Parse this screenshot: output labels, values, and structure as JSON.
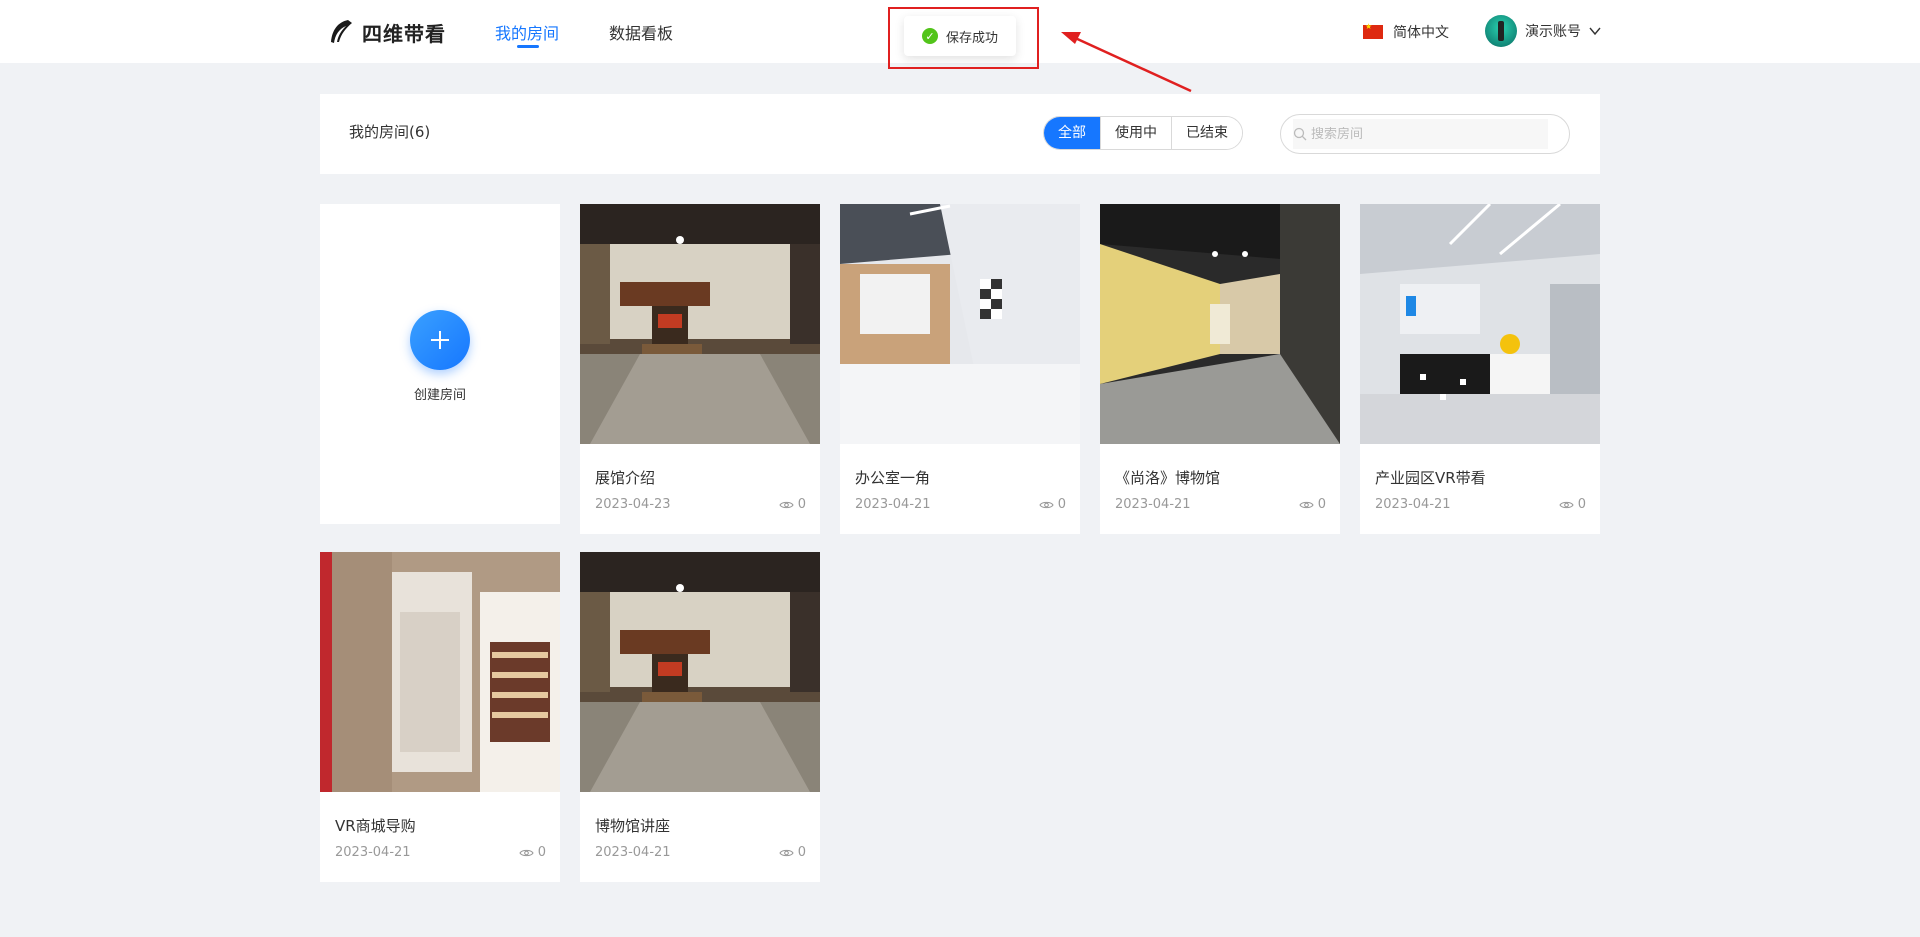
{
  "header": {
    "logo_text": "四维带看",
    "nav": [
      {
        "label": "我的房间",
        "active": true
      },
      {
        "label": "数据看板",
        "active": false
      }
    ],
    "language": "简体中文",
    "account": "演示账号"
  },
  "toast": {
    "message": "保存成功",
    "status_color": "#52c41a"
  },
  "toolbar": {
    "title": "我的房间(6)",
    "filters": [
      {
        "label": "全部",
        "active": true
      },
      {
        "label": "使用中",
        "active": false
      },
      {
        "label": "已结束",
        "active": false
      }
    ],
    "search_placeholder": "搜索房间"
  },
  "create": {
    "label": "创建房间"
  },
  "rooms": [
    {
      "name": "展馆介绍",
      "date": "2023-04-23",
      "views": "0",
      "scene": "hall"
    },
    {
      "name": "办公室一角",
      "date": "2023-04-21",
      "views": "0",
      "scene": "office"
    },
    {
      "name": "《尚洛》博物馆",
      "date": "2023-04-21",
      "views": "0",
      "scene": "museum"
    },
    {
      "name": "产业园区VR带看",
      "date": "2023-04-21",
      "views": "0",
      "scene": "park"
    },
    {
      "name": "VR商城导购",
      "date": "2023-04-21",
      "views": "0",
      "scene": "mall"
    },
    {
      "name": "博物馆讲座",
      "date": "2023-04-21",
      "views": "0",
      "scene": "hall"
    }
  ],
  "colors": {
    "accent": "#1677ff",
    "highlight": "#e02020",
    "background": "#f0f2f5"
  }
}
